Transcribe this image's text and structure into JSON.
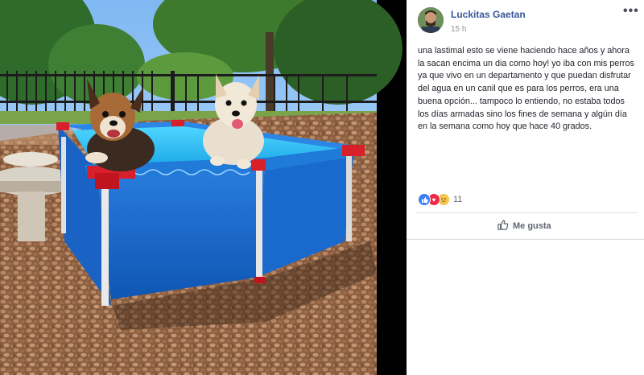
{
  "post": {
    "author_name": "Luckitas Gaetan",
    "time": "15 h",
    "more_icon": "more-options-icon",
    "text": "una lastimal esto se viene haciendo hace años y ahora la sacan encima un dia como hoy! yo iba con mis perros ya que vivo en un departamento y que puedan disfrutar del agua en un canil que es para los perros, era una buena opción... tampoco lo entiendo, no estaba todos los días armadas sino los fines de semana y algún día en la semana como hoy que hace 40 grados."
  },
  "photo": {
    "subject": "two-dogs-in-blue-pool"
  },
  "reactions": {
    "icons": [
      "like-icon",
      "love-icon",
      "sad-icon"
    ],
    "count": "11"
  },
  "actions": {
    "like_label": "Me gusta"
  },
  "colors": {
    "author": "#385898",
    "pool_blue": "#1f6fd0",
    "like_reaction": "#3b7ff2",
    "love_reaction": "#f0284a",
    "sad_reaction": "#f7c64a"
  }
}
